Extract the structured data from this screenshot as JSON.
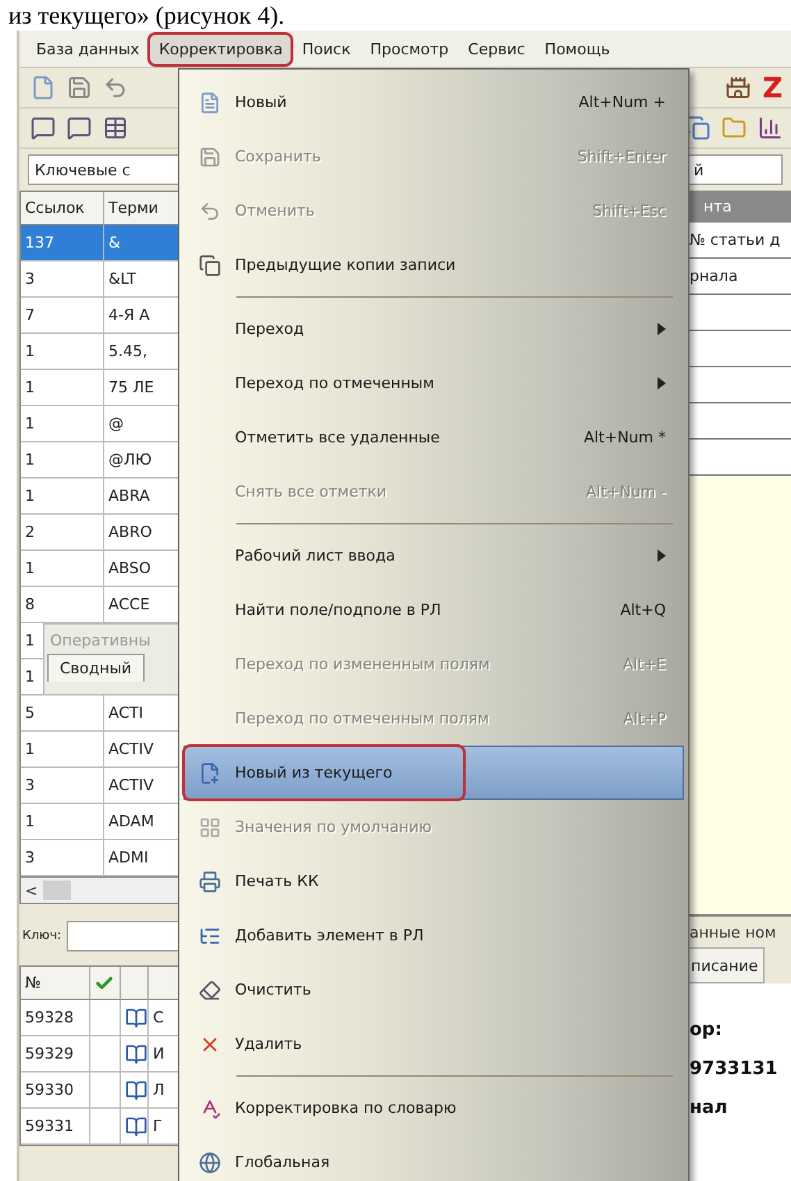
{
  "caption": "из текущего» (рисунок 4).",
  "menubar": [
    {
      "label": "База данных",
      "selected": false,
      "annotated": false
    },
    {
      "label": "Корректировка",
      "selected": true,
      "annotated": true
    },
    {
      "label": "Поиск",
      "selected": false,
      "annotated": false
    },
    {
      "label": "Просмотр",
      "selected": false,
      "annotated": false
    },
    {
      "label": "Сервис",
      "selected": false,
      "annotated": false
    },
    {
      "label": "Помощь",
      "selected": false,
      "annotated": false
    }
  ],
  "toolbar_letter": "Z",
  "search": {
    "value": "Ключевые с"
  },
  "search_right": {
    "value": "й"
  },
  "terms_table": {
    "columns": [
      "Ссылок",
      "Терми"
    ],
    "rows": [
      {
        "refs": "137",
        "term": "&",
        "selected": true
      },
      {
        "refs": "3",
        "term": "&LT",
        "selected": false
      },
      {
        "refs": "7",
        "term": "4-Я А",
        "selected": false
      },
      {
        "refs": "1",
        "term": "5.45,",
        "selected": false
      },
      {
        "refs": "1",
        "term": "75 ЛЕ",
        "selected": false
      },
      {
        "refs": "1",
        "term": "@",
        "selected": false
      },
      {
        "refs": "1",
        "term": "@ЛЮ",
        "selected": false
      },
      {
        "refs": "1",
        "term": "ABRA",
        "selected": false
      },
      {
        "refs": "2",
        "term": "ABRO",
        "selected": false
      },
      {
        "refs": "1",
        "term": "ABSO",
        "selected": false
      },
      {
        "refs": "8",
        "term": "ACCE",
        "selected": false
      }
    ],
    "overlay": {
      "refs": [
        "1",
        "1"
      ],
      "title": "Оперативны",
      "tab": "Сводный"
    },
    "rows_after": [
      {
        "refs": "5",
        "term": "ACTI",
        "selected": false
      },
      {
        "refs": "1",
        "term": "ACTIV",
        "selected": false
      },
      {
        "refs": "3",
        "term": "ACTIV",
        "selected": false
      },
      {
        "refs": "1",
        "term": "ADAM",
        "selected": false
      },
      {
        "refs": "3",
        "term": "ADMI",
        "selected": false
      }
    ],
    "scroll_left": "<"
  },
  "key_field": {
    "label": "Ключ:"
  },
  "records_table": {
    "column": "№",
    "checked": true,
    "rows": [
      {
        "number": "59328",
        "title": "С"
      },
      {
        "number": "59329",
        "title": "И"
      },
      {
        "number": "59330",
        "title": "Л"
      },
      {
        "number": "59331",
        "title": "Г"
      }
    ]
  },
  "right_panel": {
    "column": "нта",
    "rows": [
      "№ статьи д",
      "рнала"
    ],
    "status": "анные ном",
    "tab": "писание",
    "details": [
      "ор:",
      "9733131",
      "нал"
    ]
  },
  "menu": {
    "items": [
      {
        "kind": "item",
        "label": "Новый",
        "shortcut": "Alt+Num +",
        "disabled": false,
        "submenu": false,
        "highlighted": false,
        "annotated": false
      },
      {
        "kind": "item",
        "label": "Сохранить",
        "shortcut": "Shift+Enter",
        "disabled": true,
        "submenu": false,
        "highlighted": false,
        "annotated": false
      },
      {
        "kind": "item",
        "label": "Отменить",
        "shortcut": "Shift+Esc",
        "disabled": true,
        "submenu": false,
        "highlighted": false,
        "annotated": false
      },
      {
        "kind": "item",
        "label": "Предыдущие копии записи",
        "disabled": false,
        "submenu": false,
        "highlighted": false,
        "annotated": false
      },
      {
        "kind": "separator"
      },
      {
        "kind": "item",
        "label": "Переход",
        "disabled": false,
        "submenu": true,
        "highlighted": false,
        "annotated": false
      },
      {
        "kind": "item",
        "label": "Переход по отмеченным",
        "disabled": false,
        "submenu": true,
        "highlighted": false,
        "annotated": false
      },
      {
        "kind": "item",
        "label": "Отметить все удаленные",
        "shortcut": "Alt+Num *",
        "disabled": false,
        "submenu": false,
        "highlighted": false,
        "annotated": false
      },
      {
        "kind": "item",
        "label": "Снять все отметки",
        "shortcut": "Alt+Num -",
        "disabled": true,
        "submenu": false,
        "highlighted": false,
        "annotated": false
      },
      {
        "kind": "separator"
      },
      {
        "kind": "item",
        "label": "Рабочий лист ввода",
        "disabled": false,
        "submenu": true,
        "highlighted": false,
        "annotated": false
      },
      {
        "kind": "item",
        "label": "Найти поле/подполе в РЛ",
        "shortcut": "Alt+Q",
        "disabled": false,
        "submenu": false,
        "highlighted": false,
        "annotated": false
      },
      {
        "kind": "item",
        "label": "Переход по измененным полям",
        "shortcut": "Alt+E",
        "disabled": true,
        "submenu": false,
        "highlighted": false,
        "annotated": false
      },
      {
        "kind": "item",
        "label": "Переход по отмеченным полям",
        "shortcut": "Alt+P",
        "disabled": true,
        "submenu": false,
        "highlighted": false,
        "annotated": false
      },
      {
        "kind": "item",
        "label": "Новый из текущего",
        "disabled": false,
        "submenu": false,
        "highlighted": true,
        "annotated": true
      },
      {
        "kind": "item",
        "label": "Значения по умолчанию",
        "disabled": true,
        "submenu": false,
        "highlighted": false,
        "annotated": false
      },
      {
        "kind": "item",
        "label": "Печать КК",
        "disabled": false,
        "submenu": false,
        "highlighted": false,
        "annotated": false
      },
      {
        "kind": "item",
        "label": "Добавить элемент в РЛ",
        "disabled": false,
        "submenu": false,
        "highlighted": false,
        "annotated": false
      },
      {
        "kind": "item",
        "label": "Очистить",
        "disabled": false,
        "submenu": false,
        "highlighted": false,
        "annotated": false
      },
      {
        "kind": "item",
        "label": "Удалить",
        "disabled": false,
        "submenu": false,
        "highlighted": false,
        "annotated": false
      },
      {
        "kind": "separator"
      },
      {
        "kind": "item",
        "label": "Корректировка по словарю",
        "disabled": false,
        "submenu": false,
        "highlighted": false,
        "annotated": false
      },
      {
        "kind": "item",
        "label": "Глобальная",
        "disabled": false,
        "submenu": false,
        "highlighted": false,
        "annotated": false
      }
    ]
  }
}
